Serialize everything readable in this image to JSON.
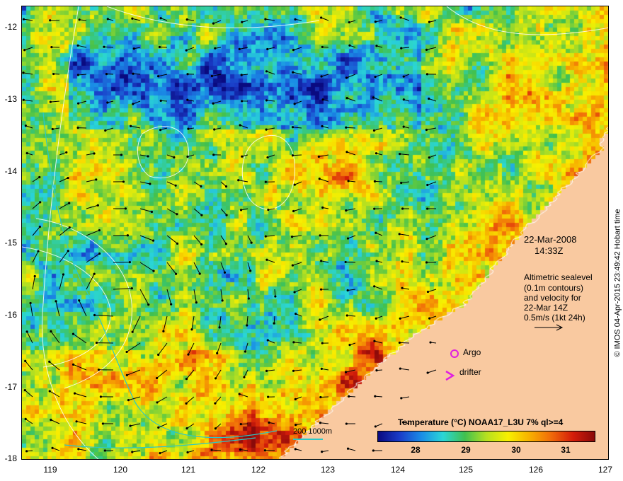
{
  "map": {
    "y_ticks": [
      "-12",
      "-13",
      "-14",
      "-15",
      "-16",
      "-17",
      "-18"
    ],
    "x_ticks": [
      "119",
      "120",
      "121",
      "122",
      "123",
      "124",
      "125",
      "126",
      "127"
    ],
    "date": "22-Mar-2008",
    "time": "14:33Z",
    "info_lines": [
      "Altimetric sealevel",
      "(0.1m contours)",
      "and velocity for",
      "22-Mar 14Z",
      "0.5m/s (1kt 24h)"
    ],
    "legend": {
      "argo": "Argo",
      "drifter": "drifter",
      "argo_color": "#e020e0",
      "drifter_color": "#e020e0"
    },
    "colorbar": {
      "title": "Temperature (°C) NOAA17_L3U 7% ql>=4",
      "ticks": [
        "28",
        "29",
        "30",
        "31"
      ],
      "range": [
        27.5,
        31.5
      ]
    },
    "depth_scale": "200  1000m",
    "credit": "© IMOS 04-Apr-2015 23:49:42 Hobart time",
    "colors": {
      "land": "#f9c9a0",
      "contour": "#ffffff",
      "isobath": "#2ac8c8",
      "arrow": "#000000"
    }
  }
}
